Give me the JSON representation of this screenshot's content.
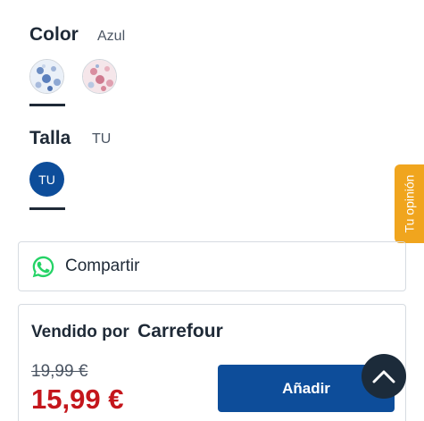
{
  "color": {
    "label": "Color",
    "value": "Azul",
    "options": [
      {
        "name": "Azul",
        "icon": "blue-pattern-swatch"
      },
      {
        "name": "pink",
        "icon": "pink-pattern-swatch"
      }
    ]
  },
  "size": {
    "label": "Talla",
    "value": "TU",
    "options": [
      {
        "label": "TU"
      }
    ]
  },
  "feedback_tab": {
    "label": "Tu opinión"
  },
  "share": {
    "label": "Compartir",
    "icon": "whatsapp-icon"
  },
  "seller": {
    "prefix": "Vendido por",
    "name": "Carrefour",
    "old_price": "19,99 €",
    "price": "15,99 €",
    "add_label": "Añadir"
  },
  "scroll_top": {
    "icon": "chevron-up-icon"
  },
  "colors": {
    "primary": "#0d4d9a",
    "price_red": "#c4161c",
    "feedback_orange": "#f0a51e",
    "whatsapp_green": "#25d366",
    "dark": "#1c2b3a"
  }
}
